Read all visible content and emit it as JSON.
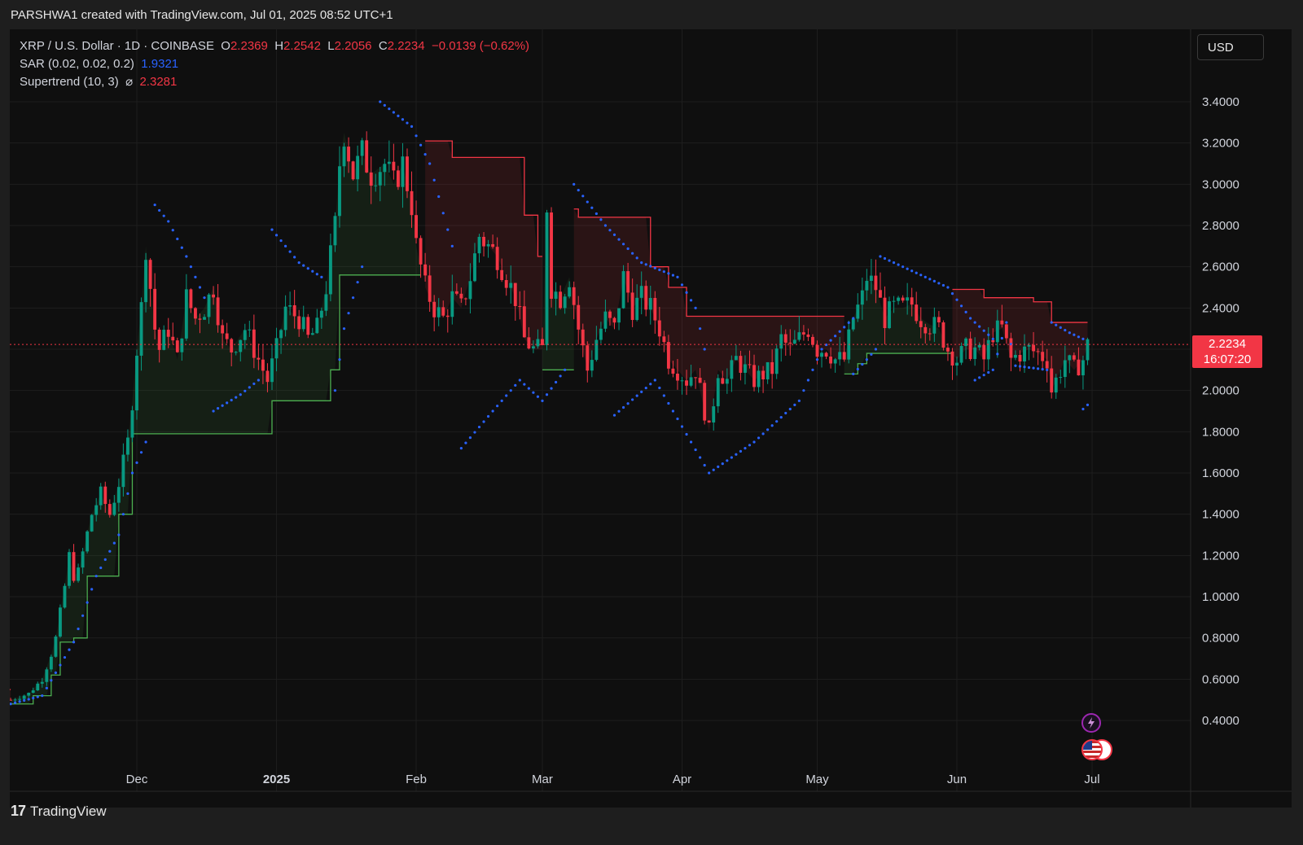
{
  "header": {
    "credit": "PARSHWA1 created with TradingView.com, Jul 01, 2025 08:52 UTC+1"
  },
  "legend": {
    "symbol": "XRP / U.S. Dollar · 1D · COINBASE",
    "o_label": "O",
    "o_value": "2.2369",
    "h_label": "H",
    "h_value": "2.2542",
    "l_label": "L",
    "l_value": "2.2056",
    "c_label": "C",
    "c_value": "2.2234",
    "change": "−0.0139 (−0.62%)",
    "sar_label": "SAR (0.02, 0.02, 0.2)",
    "sar_value": "1.9321",
    "supertrend_label": "Supertrend (10, 3)",
    "supertrend_icon": "⌀",
    "supertrend_value": "2.3281"
  },
  "currency_button": "USD",
  "last_price": {
    "value": "2.2234",
    "countdown": "16:07:20"
  },
  "branding": {
    "name": "TradingView",
    "mark": "17"
  },
  "colors": {
    "up": "#089981",
    "down": "#f23645",
    "sar": "#2962ff",
    "trend_up": "#4caf50",
    "trend_down": "#f23645",
    "bg": "#0f0f0f",
    "grid": "#1e1e1e"
  },
  "chart_data": {
    "type": "candlestick",
    "x_ticks": [
      {
        "label": "Dec",
        "date": "2024-12-01",
        "bold": false
      },
      {
        "label": "2025",
        "date": "2025-01-01",
        "bold": true
      },
      {
        "label": "Feb",
        "date": "2025-02-01",
        "bold": false
      },
      {
        "label": "Mar",
        "date": "2025-03-01",
        "bold": false
      },
      {
        "label": "Apr",
        "date": "2025-04-01",
        "bold": false
      },
      {
        "label": "May",
        "date": "2025-05-01",
        "bold": false
      },
      {
        "label": "Jun",
        "date": "2025-06-01",
        "bold": false
      },
      {
        "label": "Jul",
        "date": "2025-07-01",
        "bold": false
      }
    ],
    "y_ticks": [
      "3.4000",
      "3.2000",
      "3.0000",
      "2.8000",
      "2.6000",
      "2.4000",
      "2.2000",
      "2.0000",
      "1.8000",
      "1.6000",
      "1.4000",
      "1.2000",
      "1.0000",
      "0.8000",
      "0.6000",
      "0.4000"
    ],
    "ylim": [
      0.2,
      3.6
    ],
    "last_price": 2.2234,
    "price_series": [
      [
        "2024-11-03",
        0.5
      ],
      [
        "2024-11-07",
        0.53
      ],
      [
        "2024-11-10",
        0.6
      ],
      [
        "2024-11-12",
        0.72
      ],
      [
        "2024-11-13",
        0.8
      ],
      [
        "2024-11-15",
        1.05
      ],
      [
        "2024-11-16",
        1.2
      ],
      [
        "2024-11-17",
        1.1
      ],
      [
        "2024-11-18",
        1.12
      ],
      [
        "2024-11-21",
        1.4
      ],
      [
        "2024-11-23",
        1.5
      ],
      [
        "2024-11-25",
        1.4
      ],
      [
        "2024-11-27",
        1.55
      ],
      [
        "2024-11-29",
        1.75
      ],
      [
        "2024-11-30",
        1.95
      ],
      [
        "2024-12-01",
        2.2
      ],
      [
        "2024-12-02",
        2.4
      ],
      [
        "2024-12-03",
        2.7
      ],
      [
        "2024-12-04",
        2.5
      ],
      [
        "2024-12-05",
        2.3
      ],
      [
        "2024-12-06",
        2.2
      ],
      [
        "2024-12-08",
        2.3
      ],
      [
        "2024-12-10",
        2.15
      ],
      [
        "2024-12-12",
        2.45
      ],
      [
        "2024-12-14",
        2.35
      ],
      [
        "2024-12-16",
        2.4
      ],
      [
        "2024-12-18",
        2.5
      ],
      [
        "2024-12-20",
        2.25
      ],
      [
        "2024-12-22",
        2.2
      ],
      [
        "2024-12-25",
        2.3
      ],
      [
        "2024-12-28",
        2.15
      ],
      [
        "2024-12-30",
        2.05
      ],
      [
        "2025-01-01",
        2.2
      ],
      [
        "2025-01-03",
        2.4
      ],
      [
        "2025-01-06",
        2.35
      ],
      [
        "2025-01-08",
        2.25
      ],
      [
        "2025-01-10",
        2.3
      ],
      [
        "2025-01-12",
        2.5
      ],
      [
        "2025-01-14",
        2.8
      ],
      [
        "2025-01-15",
        3.1
      ],
      [
        "2025-01-16",
        3.25
      ],
      [
        "2025-01-17",
        3.15
      ],
      [
        "2025-01-18",
        3.05
      ],
      [
        "2025-01-20",
        3.15
      ],
      [
        "2025-01-22",
        3.05
      ],
      [
        "2025-01-25",
        3.1
      ],
      [
        "2025-01-27",
        3.0
      ],
      [
        "2025-01-29",
        3.1
      ],
      [
        "2025-01-31",
        2.9
      ],
      [
        "2025-02-01",
        2.7
      ],
      [
        "2025-02-03",
        2.5
      ],
      [
        "2025-02-05",
        2.4
      ],
      [
        "2025-02-07",
        2.35
      ],
      [
        "2025-02-09",
        2.45
      ],
      [
        "2025-02-11",
        2.4
      ],
      [
        "2025-02-13",
        2.55
      ],
      [
        "2025-02-15",
        2.75
      ],
      [
        "2025-02-17",
        2.7
      ],
      [
        "2025-02-19",
        2.65
      ],
      [
        "2025-02-21",
        2.55
      ],
      [
        "2025-02-23",
        2.45
      ],
      [
        "2025-02-25",
        2.25
      ],
      [
        "2025-02-27",
        2.2
      ],
      [
        "2025-03-01",
        2.2
      ],
      [
        "2025-03-02",
        2.9
      ],
      [
        "2025-03-03",
        2.5
      ],
      [
        "2025-03-05",
        2.45
      ],
      [
        "2025-03-07",
        2.55
      ],
      [
        "2025-03-09",
        2.3
      ],
      [
        "2025-03-11",
        2.1
      ],
      [
        "2025-03-13",
        2.25
      ],
      [
        "2025-03-15",
        2.35
      ],
      [
        "2025-03-17",
        2.3
      ],
      [
        "2025-03-19",
        2.55
      ],
      [
        "2025-03-21",
        2.4
      ],
      [
        "2025-03-23",
        2.45
      ],
      [
        "2025-03-25",
        2.4
      ],
      [
        "2025-03-27",
        2.3
      ],
      [
        "2025-03-29",
        2.15
      ],
      [
        "2025-03-31",
        2.1
      ],
      [
        "2025-04-02",
        2.05
      ],
      [
        "2025-04-04",
        2.1
      ],
      [
        "2025-04-06",
        1.9
      ],
      [
        "2025-04-07",
        1.8
      ],
      [
        "2025-04-09",
        2.1
      ],
      [
        "2025-04-11",
        2.05
      ],
      [
        "2025-04-13",
        2.15
      ],
      [
        "2025-04-15",
        2.1
      ],
      [
        "2025-04-17",
        2.05
      ],
      [
        "2025-04-19",
        2.08
      ],
      [
        "2025-04-21",
        2.1
      ],
      [
        "2025-04-23",
        2.25
      ],
      [
        "2025-04-25",
        2.2
      ],
      [
        "2025-04-27",
        2.25
      ],
      [
        "2025-04-29",
        2.3
      ],
      [
        "2025-05-01",
        2.2
      ],
      [
        "2025-05-03",
        2.2
      ],
      [
        "2025-05-05",
        2.15
      ],
      [
        "2025-05-07",
        2.15
      ],
      [
        "2025-05-09",
        2.35
      ],
      [
        "2025-05-11",
        2.45
      ],
      [
        "2025-05-12",
        2.55
      ],
      [
        "2025-05-14",
        2.5
      ],
      [
        "2025-05-16",
        2.35
      ],
      [
        "2025-05-18",
        2.4
      ],
      [
        "2025-05-20",
        2.4
      ],
      [
        "2025-05-22",
        2.42
      ],
      [
        "2025-05-24",
        2.35
      ],
      [
        "2025-05-26",
        2.32
      ],
      [
        "2025-05-28",
        2.3
      ],
      [
        "2025-05-30",
        2.2
      ],
      [
        "2025-06-01",
        2.15
      ],
      [
        "2025-06-03",
        2.2
      ],
      [
        "2025-06-05",
        2.2
      ],
      [
        "2025-06-07",
        2.15
      ],
      [
        "2025-06-09",
        2.28
      ],
      [
        "2025-06-11",
        2.3
      ],
      [
        "2025-06-13",
        2.15
      ],
      [
        "2025-06-15",
        2.18
      ],
      [
        "2025-06-17",
        2.2
      ],
      [
        "2025-06-19",
        2.18
      ],
      [
        "2025-06-21",
        2.15
      ],
      [
        "2025-06-22",
        2.0
      ],
      [
        "2025-06-23",
        2.05
      ],
      [
        "2025-06-25",
        2.15
      ],
      [
        "2025-06-27",
        2.1
      ],
      [
        "2025-06-29",
        2.15
      ],
      [
        "2025-06-30",
        2.22
      ]
    ],
    "sar_series": [
      [
        "2024-11-03",
        0.48
      ],
      [
        "2024-11-10",
        0.52
      ],
      [
        "2024-11-17",
        0.78
      ],
      [
        "2024-11-22",
        1.1
      ],
      [
        "2024-11-27",
        1.3
      ],
      [
        "2024-11-30",
        1.6
      ],
      [
        "2024-12-03",
        1.75
      ],
      [
        "2024-12-05",
        2.9
      ],
      [
        "2024-12-08",
        2.82
      ],
      [
        "2024-12-12",
        2.65
      ],
      [
        "2024-12-16",
        2.45
      ],
      [
        "2024-12-18",
        1.9
      ],
      [
        "2024-12-24",
        1.98
      ],
      [
        "2024-12-28",
        2.05
      ],
      [
        "2024-12-31",
        2.78
      ],
      [
        "2025-01-06",
        2.62
      ],
      [
        "2025-01-11",
        2.55
      ],
      [
        "2025-01-14",
        2.0
      ],
      [
        "2025-01-16",
        2.3
      ],
      [
        "2025-01-20",
        2.6
      ],
      [
        "2025-01-24",
        3.4
      ],
      [
        "2025-01-31",
        3.28
      ],
      [
        "2025-02-04",
        3.1
      ],
      [
        "2025-02-09",
        2.7
      ],
      [
        "2025-02-11",
        1.72
      ],
      [
        "2025-02-18",
        1.9
      ],
      [
        "2025-02-24",
        2.05
      ],
      [
        "2025-03-01",
        1.95
      ],
      [
        "2025-03-06",
        2.1
      ],
      [
        "2025-03-08",
        3.0
      ],
      [
        "2025-03-15",
        2.8
      ],
      [
        "2025-03-23",
        2.62
      ],
      [
        "2025-03-31",
        2.55
      ],
      [
        "2025-04-04",
        2.4
      ],
      [
        "2025-04-06",
        2.2
      ],
      [
        "2025-03-17",
        1.88
      ],
      [
        "2025-03-26",
        2.05
      ],
      [
        "2025-04-07",
        1.6
      ],
      [
        "2025-04-17",
        1.75
      ],
      [
        "2025-04-27",
        1.95
      ],
      [
        "2025-05-02",
        2.2
      ],
      [
        "2025-05-09",
        2.35
      ],
      [
        "2025-05-09",
        2.08
      ],
      [
        "2025-05-12",
        2.15
      ],
      [
        "2025-05-14",
        2.2
      ],
      [
        "2025-05-15",
        2.65
      ],
      [
        "2025-05-22",
        2.58
      ],
      [
        "2025-05-30",
        2.5
      ],
      [
        "2025-06-04",
        2.35
      ],
      [
        "2025-06-09",
        2.25
      ],
      [
        "2025-06-05",
        2.05
      ],
      [
        "2025-06-09",
        2.1
      ],
      [
        "2025-06-12",
        2.33
      ],
      [
        "2025-06-14",
        2.12
      ],
      [
        "2025-06-21",
        2.1
      ],
      [
        "2025-06-22",
        2.33
      ],
      [
        "2025-06-26",
        2.28
      ],
      [
        "2025-06-29",
        2.25
      ],
      [
        "2025-06-29",
        1.91
      ],
      [
        "2025-06-30",
        1.93
      ]
    ],
    "supertrend_up": [
      [
        [
          "2024-11-03",
          0.48
        ],
        [
          "2024-11-08",
          0.52
        ],
        [
          "2024-11-12",
          0.62
        ],
        [
          "2024-11-14",
          0.78
        ],
        [
          "2024-11-17",
          0.8
        ],
        [
          "2024-11-20",
          1.1
        ],
        [
          "2024-11-25",
          1.1
        ],
        [
          "2024-11-27",
          1.4
        ],
        [
          "2024-11-30",
          1.79
        ],
        [
          "2024-12-29",
          1.79
        ],
        [
          "2024-12-31",
          1.95
        ],
        [
          "2025-01-10",
          1.95
        ],
        [
          "2025-01-13",
          2.1
        ],
        [
          "2025-01-15",
          2.56
        ],
        [
          "2025-02-02",
          2.56
        ]
      ],
      [
        [
          "2025-03-01",
          2.1
        ],
        [
          "2025-03-08",
          2.1
        ]
      ],
      [
        [
          "2025-05-07",
          2.08
        ],
        [
          "2025-05-10",
          2.13
        ],
        [
          "2025-05-12",
          2.18
        ],
        [
          "2025-05-31",
          2.18
        ]
      ]
    ],
    "supertrend_down": [
      [
        [
          "2024-11-01",
          0.55
        ],
        [
          "2024-11-03",
          0.55
        ]
      ],
      [
        [
          "2025-02-03",
          3.21
        ],
        [
          "2025-02-07",
          3.21
        ],
        [
          "2025-02-09",
          3.13
        ],
        [
          "2025-02-21",
          3.13
        ],
        [
          "2025-02-25",
          2.85
        ],
        [
          "2025-02-28",
          2.65
        ],
        [
          "2025-03-01",
          2.65
        ]
      ],
      [
        [
          "2025-03-08",
          2.88
        ],
        [
          "2025-03-09",
          2.84
        ],
        [
          "2025-03-21",
          2.84
        ],
        [
          "2025-03-25",
          2.6
        ],
        [
          "2025-03-29",
          2.5
        ],
        [
          "2025-04-02",
          2.36
        ],
        [
          "2025-05-07",
          2.36
        ]
      ],
      [
        [
          "2025-05-31",
          2.49
        ],
        [
          "2025-06-07",
          2.45
        ],
        [
          "2025-06-18",
          2.43
        ],
        [
          "2025-06-22",
          2.33
        ],
        [
          "2025-06-30",
          2.33
        ]
      ]
    ]
  }
}
